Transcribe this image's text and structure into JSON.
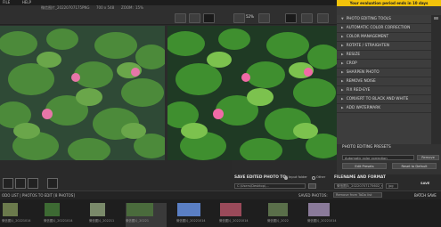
{
  "menu": {
    "file": "FILE",
    "help": "HELP"
  },
  "infobar": {
    "filename": "微信图片_20220707175",
    "size_label": "PNG",
    "dimensions": "700 x 548",
    "zoom_label": "ZOOM:",
    "zoom_value": "15%",
    "percent_left": "52%"
  },
  "trial_banner": "Your evaluation period ends in 10 days",
  "panel": {
    "title": "PHOTO EDITING TOOLS",
    "tools": [
      "AUTOMATIC COLOR CORRECTION",
      "COLOR MANAGEMENT",
      "ROTATE / STRAIGHTEN",
      "RESIZE",
      "CROP",
      "SHARPEN PHOTO",
      "REMOVE NOISE",
      "FIX RED-EYE",
      "CONVERT TO BLACK AND WHITE",
      "ADD WATERMARK"
    ]
  },
  "presets": {
    "title": "PHOTO EDITING PRESETS",
    "selected": "Automatic color correction",
    "remove_label": "Remove",
    "edit_label": "Edit Presets",
    "reset_label": "Reset to Default"
  },
  "save": {
    "title": "SAVE EDITED PHOTO TO:",
    "option_input": "Input folder",
    "option_other": "Other",
    "path": "C:\\Users\\Desktop\\...",
    "format_title": "FILENAME AND FORMAT",
    "filename": "微信图片_20220707175602_sal",
    "format": "jpg",
    "save_label": "SAVE",
    "remove_list": "Remove from ToDo list",
    "saved_photos": "SAVED PHOTOS:",
    "batch_label": "BATCH SAVE"
  },
  "list": {
    "todo": "ODO LIST | PHOTOS TO EDIT [8 PHOTOS]"
  },
  "thumbnails": [
    {
      "caption": "微信图片_20221014",
      "color": "#6b7a4c"
    },
    {
      "caption": "微信图片_20221014",
      "color": "#3d6a33"
    },
    {
      "caption": "微信图片_202211",
      "color": "#7a8a6a"
    },
    {
      "caption": "微信图片_20221",
      "color": "#4a6b3c"
    },
    {
      "caption": "微信图片_20221014",
      "color": "#5a7fc4"
    },
    {
      "caption": "微信图片_20221014",
      "color": "#9a4a5a"
    },
    {
      "caption": "微信图片_2022",
      "color": "#5a6f4a"
    },
    {
      "caption": "微信图片_20221014",
      "color": "#8a7a9a"
    }
  ]
}
